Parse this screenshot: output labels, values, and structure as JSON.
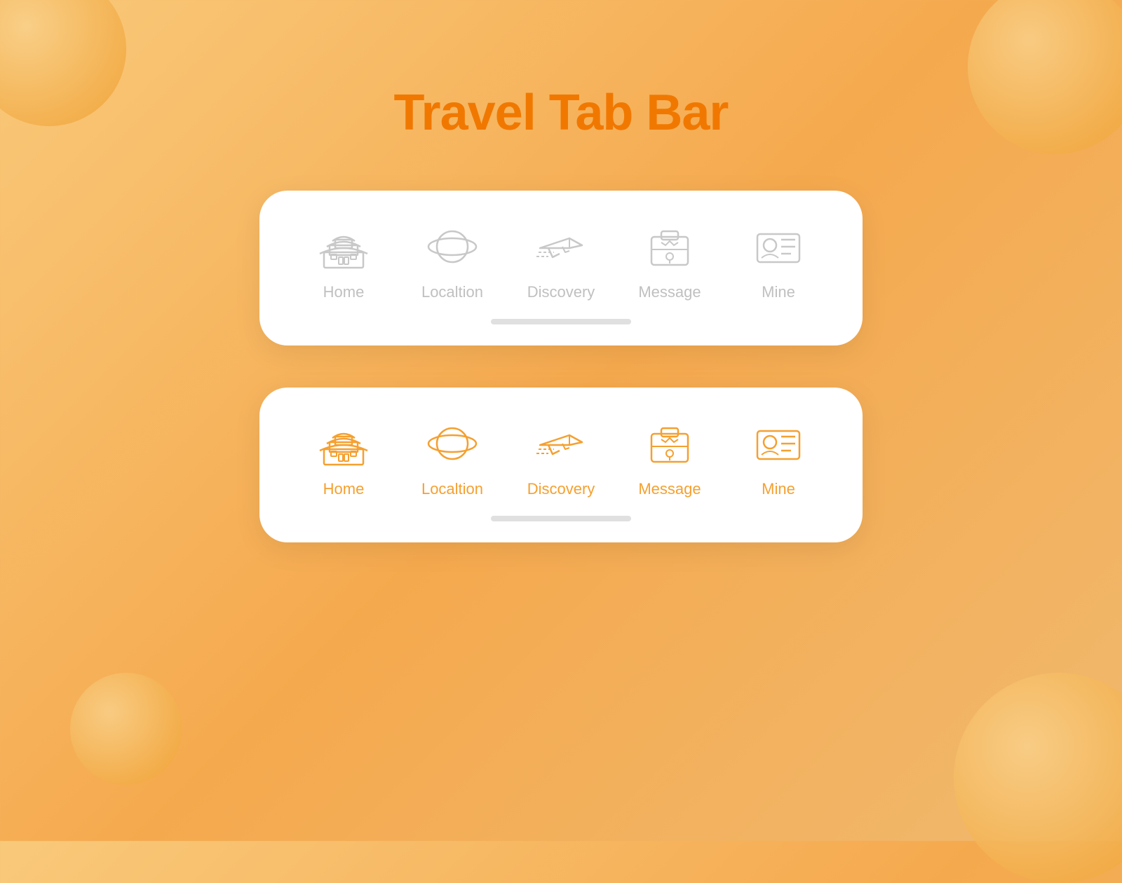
{
  "page": {
    "title": "Travel Tab Bar",
    "background_gradient_start": "#f9c97a",
    "background_gradient_end": "#f0b96e",
    "accent_color": "#f5a030",
    "inactive_color": "#c0c0c0"
  },
  "tab_bar_inactive": {
    "label": "inactive_tab_bar",
    "tabs": [
      {
        "id": "home",
        "label": "Home",
        "active": false
      },
      {
        "id": "location",
        "label": "Localtion",
        "active": false
      },
      {
        "id": "discovery",
        "label": "Discovery",
        "active": false
      },
      {
        "id": "message",
        "label": "Message",
        "active": false
      },
      {
        "id": "mine",
        "label": "Mine",
        "active": false
      }
    ]
  },
  "tab_bar_active": {
    "label": "active_tab_bar",
    "tabs": [
      {
        "id": "home",
        "label": "Home",
        "active": true
      },
      {
        "id": "location",
        "label": "Localtion",
        "active": true
      },
      {
        "id": "discovery",
        "label": "Discovery",
        "active": true
      },
      {
        "id": "message",
        "label": "Message",
        "active": true
      },
      {
        "id": "mine",
        "label": "Mine",
        "active": true
      }
    ]
  }
}
